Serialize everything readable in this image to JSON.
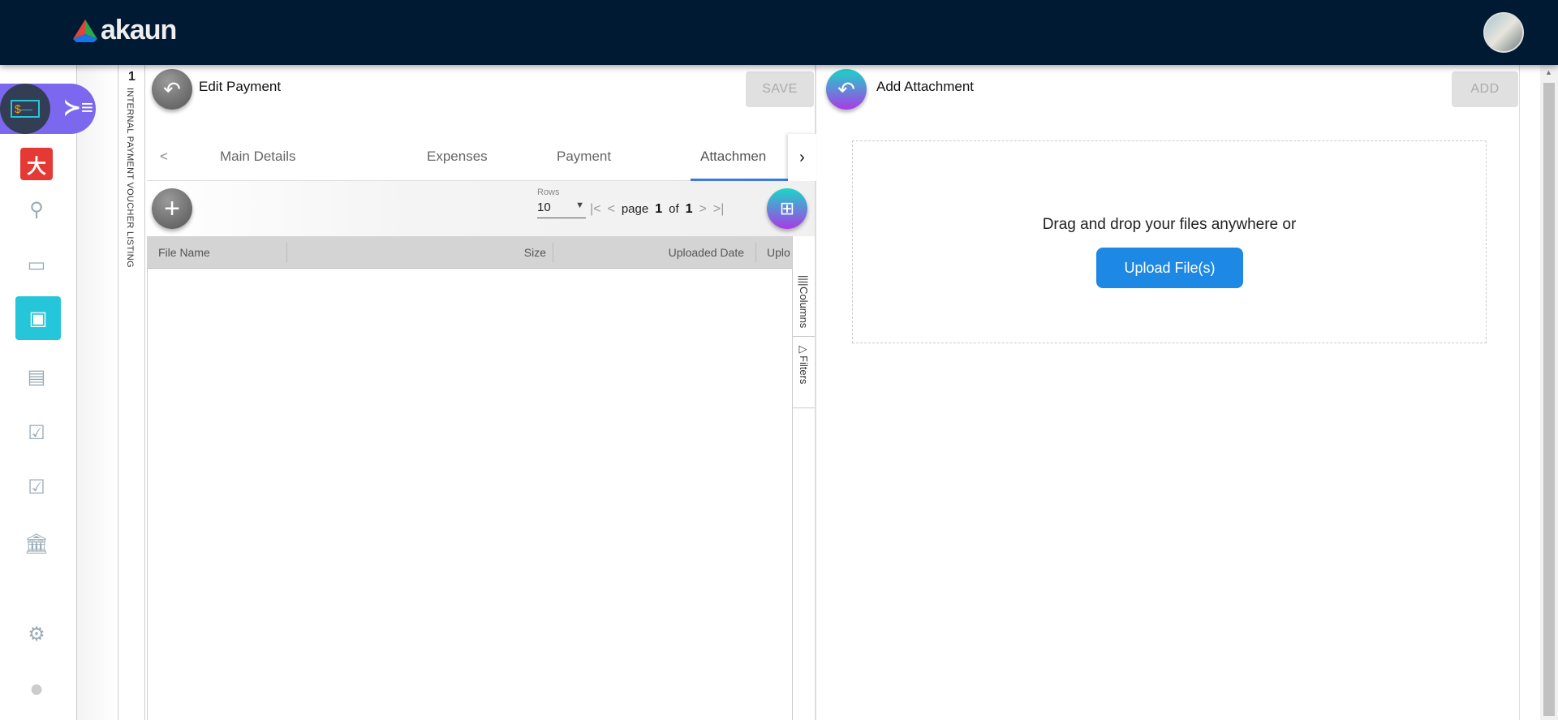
{
  "header": {
    "logo": "akaun",
    "avatar": "user-avatar"
  },
  "sidebar": {
    "items": [
      {
        "icon": "app-logo-icon"
      },
      {
        "icon": "person-icon"
      },
      {
        "icon": "card-icon"
      },
      {
        "icon": "payment-voucher-icon",
        "active": true
      },
      {
        "icon": "receipt-icon"
      },
      {
        "icon": "checklist-icon"
      },
      {
        "icon": "checklist-icon"
      },
      {
        "icon": "bank-icon"
      },
      {
        "icon": "settings-icon"
      },
      {
        "icon": "profile-icon"
      }
    ],
    "accent": "#26c6da",
    "toggle_color": "#7b68ee"
  },
  "breadcrumb_strip": {
    "count": "1",
    "label": "INTERNAL PAYMENT VOUCHER LISTING"
  },
  "left_panel": {
    "title": "Edit Payment",
    "save_label": "SAVE",
    "tabs": [
      {
        "label": "Main Details"
      },
      {
        "label": "Expenses"
      },
      {
        "label": "Payment"
      },
      {
        "label": "Attachmen",
        "active": true
      }
    ],
    "rows_label": "Rows",
    "rows_value": "10",
    "pagination": {
      "page_label": "page",
      "page": "1",
      "of_label": "of",
      "total": "1"
    },
    "columns": [
      "File Name",
      "Size",
      "Uploaded Date",
      "Uplo"
    ],
    "side_tabs": [
      "Columns",
      "Filters"
    ]
  },
  "right_panel": {
    "title": "Add Attachment",
    "add_label": "ADD",
    "drop_text": "Drag and drop your files anywhere or",
    "upload_label": "Upload File(s)",
    "upload_color": "#1e88e5"
  }
}
